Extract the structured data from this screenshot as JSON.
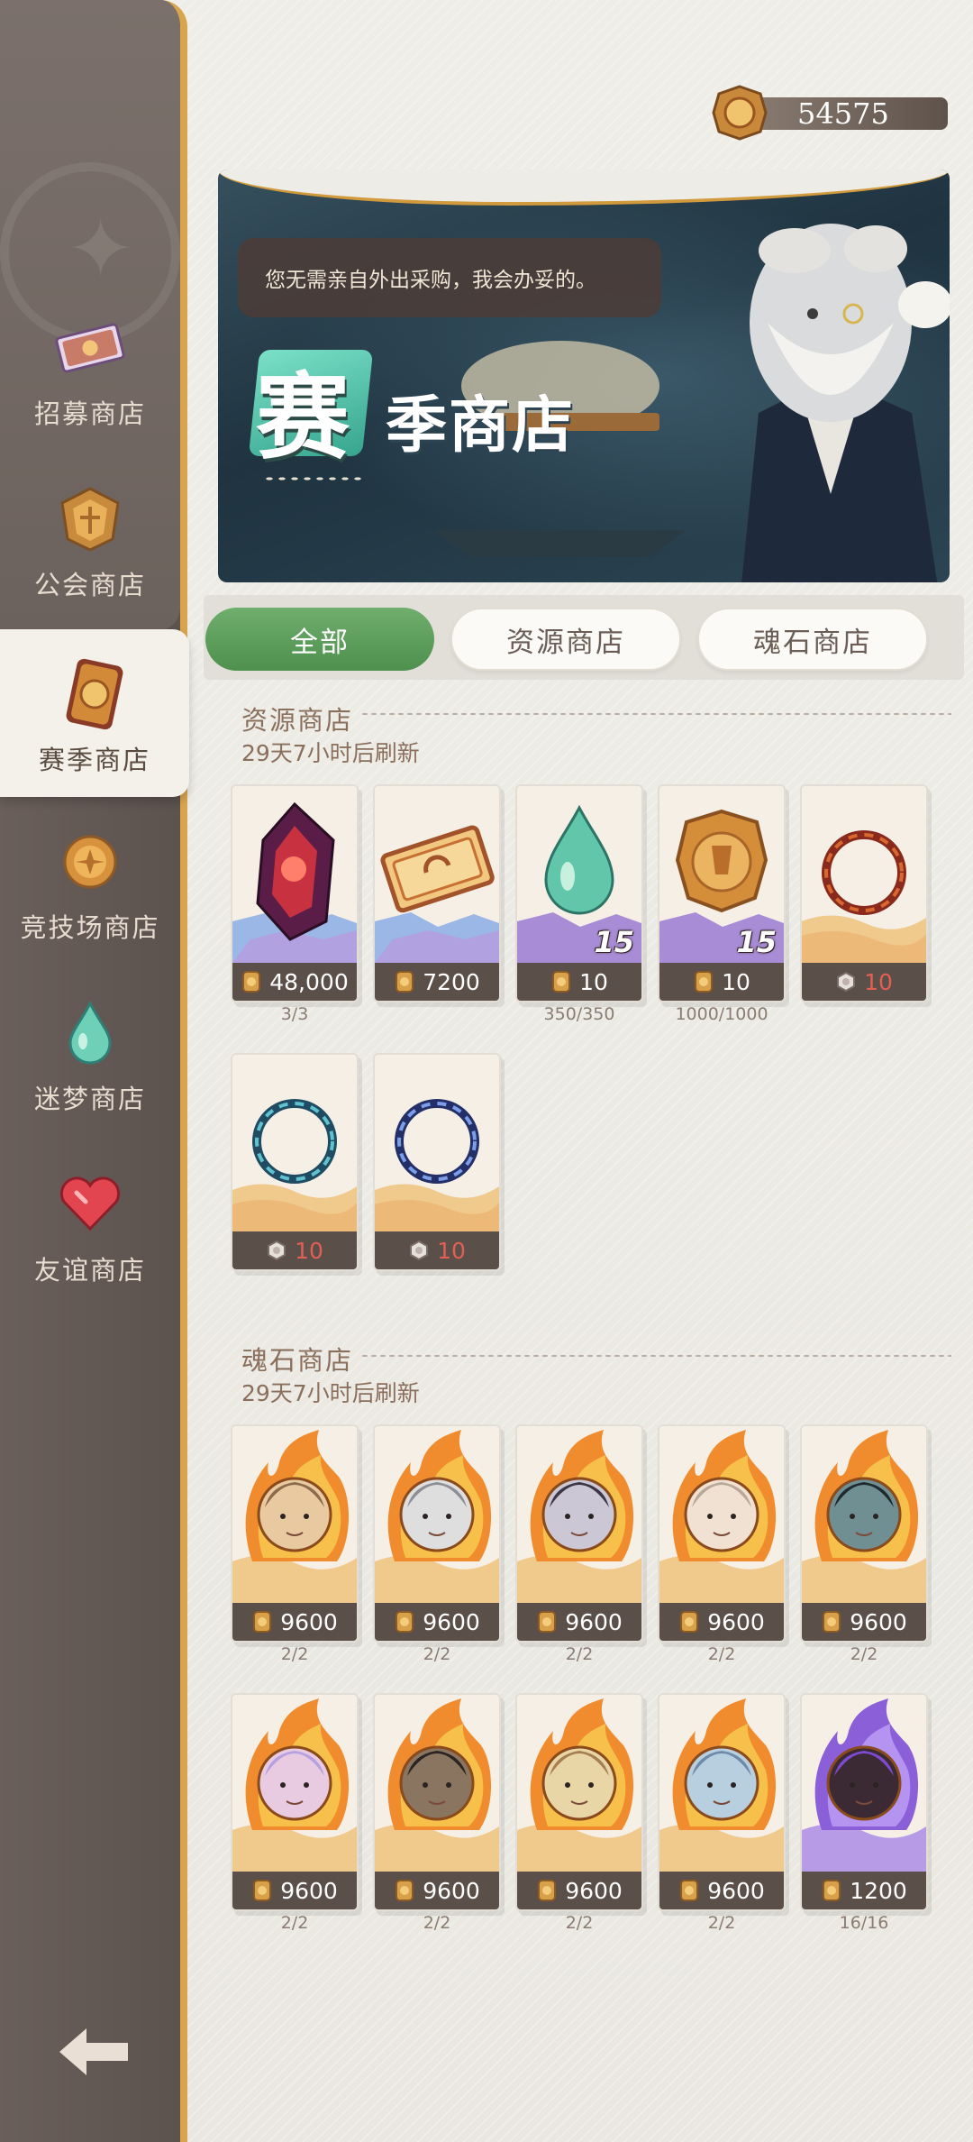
{
  "currency": {
    "value": "54575",
    "icon": "season-coin-icon"
  },
  "sidebar": {
    "items": [
      {
        "label": "招募商店",
        "icon": "recruit-ticket-icon",
        "active": false
      },
      {
        "label": "公会商店",
        "icon": "guild-badge-icon",
        "active": false
      },
      {
        "label": "赛季商店",
        "icon": "season-coin-icon",
        "active": true
      },
      {
        "label": "竞技场商店",
        "icon": "arena-medal-icon",
        "active": false
      },
      {
        "label": "迷梦商店",
        "icon": "dream-drop-icon",
        "active": false
      },
      {
        "label": "友谊商店",
        "icon": "heart-icon",
        "active": false
      }
    ],
    "back_icon": "back-arrow-icon"
  },
  "banner": {
    "speech": "您无需亲自外出采购，我会办妥的。",
    "title_first": "赛",
    "title_rest": "季商店"
  },
  "tabs": [
    {
      "label": "全部",
      "active": true
    },
    {
      "label": "资源商店",
      "active": false
    },
    {
      "label": "魂石商店",
      "active": false
    }
  ],
  "sections": [
    {
      "title": "资源商店",
      "refresh": "29天7小时后刷新",
      "items": [
        {
          "art": "red-crystal-shard",
          "price": "48,000",
          "currency": "gold-coin-icon",
          "limit": "3/3",
          "badge": "",
          "price_red": false
        },
        {
          "art": "recruit-ticket",
          "price": "7200",
          "currency": "season-coin-icon",
          "limit": "",
          "badge": "",
          "price_red": false
        },
        {
          "art": "teal-drop",
          "price": "10",
          "currency": "season-coin-icon",
          "limit": "350/350",
          "badge": "15",
          "price_red": false
        },
        {
          "art": "gold-medal",
          "price": "10",
          "currency": "season-coin-icon",
          "limit": "1000/1000",
          "badge": "15",
          "price_red": false
        },
        {
          "art": "red-frame-ring",
          "price": "10",
          "currency": "emblem-icon",
          "limit": "",
          "badge": "",
          "price_red": true
        },
        {
          "art": "teal-frame-ring",
          "price": "10",
          "currency": "emblem-icon",
          "limit": "",
          "badge": "",
          "price_red": true
        },
        {
          "art": "blue-frame-ring",
          "price": "10",
          "currency": "emblem-icon",
          "limit": "",
          "badge": "",
          "price_red": true
        }
      ]
    },
    {
      "title": "魂石商店",
      "refresh": "29天7小时后刷新",
      "items": [
        {
          "art": "soulstone-blonde",
          "price": "9600",
          "currency": "season-coin-icon",
          "limit": "2/2"
        },
        {
          "art": "soulstone-silver",
          "price": "9600",
          "currency": "season-coin-icon",
          "limit": "2/2"
        },
        {
          "art": "soulstone-darkhair",
          "price": "9600",
          "currency": "season-coin-icon",
          "limit": "2/2"
        },
        {
          "art": "soulstone-white",
          "price": "9600",
          "currency": "season-coin-icon",
          "limit": "2/2"
        },
        {
          "art": "soulstone-demon",
          "price": "9600",
          "currency": "season-coin-icon",
          "limit": "2/2"
        },
        {
          "art": "soulstone-pink",
          "price": "9600",
          "currency": "season-coin-icon",
          "limit": "2/2"
        },
        {
          "art": "soulstone-pirate",
          "price": "9600",
          "currency": "season-coin-icon",
          "limit": "2/2"
        },
        {
          "art": "soulstone-lightelf",
          "price": "9600",
          "currency": "season-coin-icon",
          "limit": "2/2"
        },
        {
          "art": "soulstone-bluehair",
          "price": "9600",
          "currency": "season-coin-icon",
          "limit": "2/2"
        },
        {
          "art": "soulstone-purple",
          "price": "1200",
          "currency": "season-coin-icon",
          "limit": "16/16"
        }
      ]
    }
  ],
  "colors": {
    "accent_green": "#5d9f5c",
    "sidebar": "#625853",
    "gold_border": "#d9a54c",
    "price_bar": "#5b4f49",
    "price_red": "#e25f55"
  }
}
